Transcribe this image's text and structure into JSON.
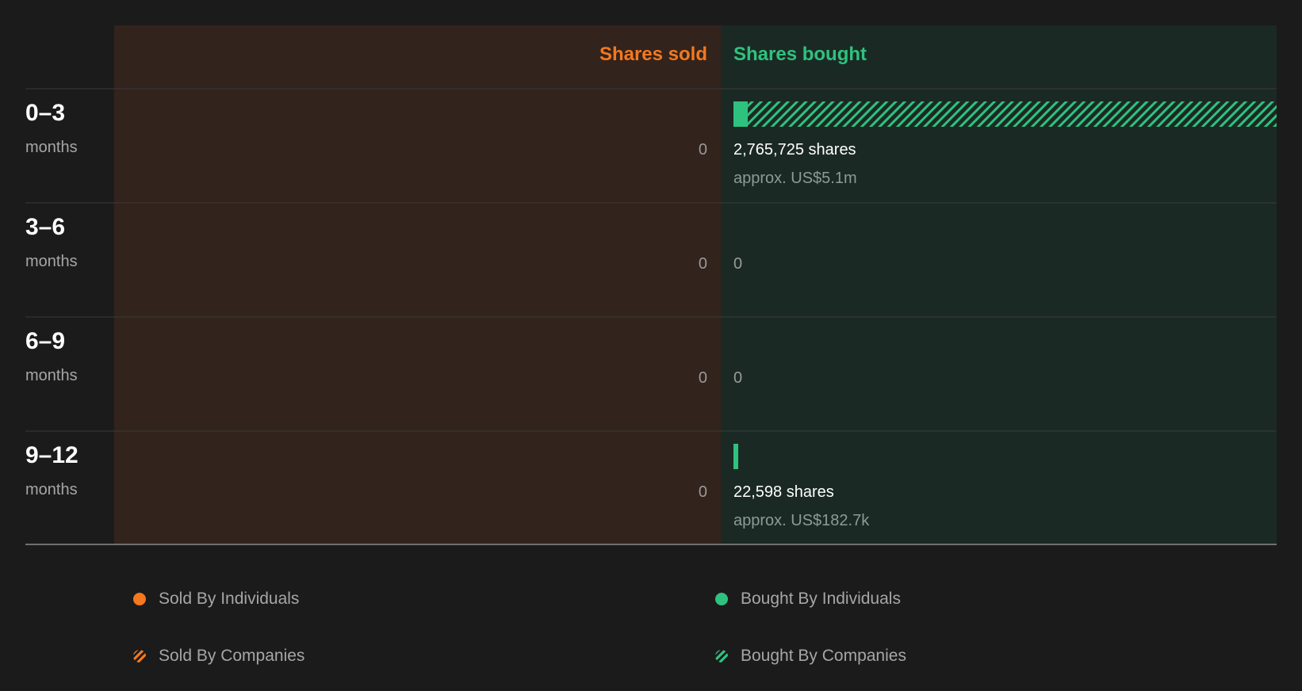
{
  "colors": {
    "sold": "#f4781e",
    "bought": "#2ec27e",
    "sold_panel": "#32231c",
    "bought_panel": "#1b2924",
    "background": "#1b1b1b"
  },
  "headers": {
    "sold": "Shares sold",
    "bought": "Shares bought"
  },
  "chart_data": {
    "type": "bar",
    "orientation": "diverging-horizontal",
    "categories": [
      {
        "range": "0–3",
        "unit": "months"
      },
      {
        "range": "3–6",
        "unit": "months"
      },
      {
        "range": "6–9",
        "unit": "months"
      },
      {
        "range": "9–12",
        "unit": "months"
      }
    ],
    "series": [
      {
        "name": "Sold By Individuals",
        "side": "sold",
        "pattern": "solid",
        "values": [
          0,
          0,
          0,
          0
        ]
      },
      {
        "name": "Sold By Companies",
        "side": "sold",
        "pattern": "hatched",
        "values": [
          0,
          0,
          0,
          0
        ]
      },
      {
        "name": "Bought By Individuals",
        "side": "bought",
        "pattern": "solid",
        "values": [
          73000,
          0,
          0,
          22598
        ]
      },
      {
        "name": "Bought By Companies",
        "side": "bought",
        "pattern": "hatched",
        "values": [
          2692725,
          0,
          0,
          0
        ]
      }
    ],
    "sold_labels": [
      "0",
      "0",
      "0",
      "0"
    ],
    "bought_labels": [
      {
        "shares": "2,765,725 shares",
        "value": "approx. US$5.1m"
      },
      {
        "shares": "0",
        "value": ""
      },
      {
        "shares": "0",
        "value": ""
      },
      {
        "shares": "22,598 shares",
        "value": "approx. US$182.7k"
      }
    ],
    "bought_max": 2765725
  },
  "legend": [
    {
      "label": "Sold By Individuals",
      "swatch": "sold-ind"
    },
    {
      "label": "Bought By Individuals",
      "swatch": "bought-ind"
    },
    {
      "label": "Sold By Companies",
      "swatch": "sold-co"
    },
    {
      "label": "Bought By Companies",
      "swatch": "bought-co"
    }
  ]
}
